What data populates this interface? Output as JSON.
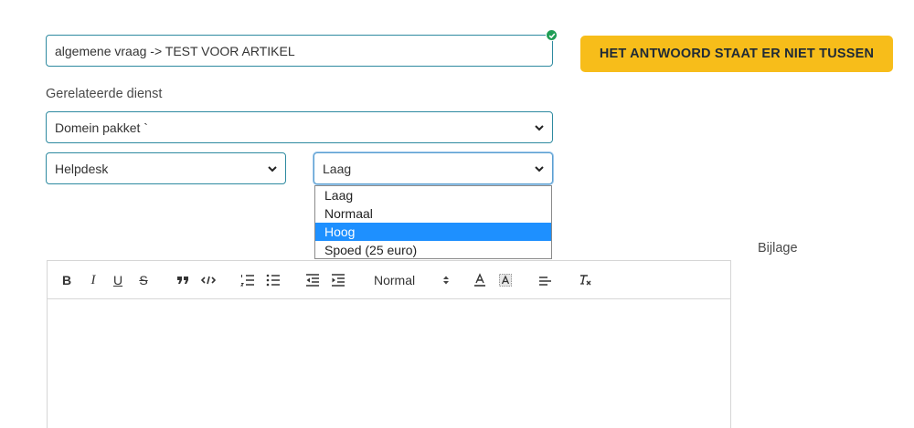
{
  "subject": {
    "value": "algemene vraag -> TEST VOOR ARTIKEL"
  },
  "answer_button": {
    "label": "HET ANTWOORD STAAT ER NIET TUSSEN"
  },
  "related_service": {
    "label": "Gerelateerde dienst",
    "selected": "Domein pakket `"
  },
  "department": {
    "selected": "Helpdesk"
  },
  "priority": {
    "selected": "Laag",
    "options": [
      "Laag",
      "Normaal",
      "Hoog",
      "Spoed (25 euro)"
    ],
    "highlighted": "Hoog"
  },
  "attachment": {
    "label": "Bijlage"
  },
  "toolbar": {
    "bold": "B",
    "italic": "I",
    "underline": "U",
    "strike": "S",
    "header_select": "Normal",
    "icons": [
      "bold-icon",
      "italic-icon",
      "underline-icon",
      "strike-icon",
      "quote-icon",
      "code-icon",
      "ordered-list-icon",
      "bullet-list-icon",
      "outdent-icon",
      "indent-icon",
      "font-color-icon",
      "background-color-icon",
      "align-icon",
      "clear-format-icon"
    ]
  },
  "colors": {
    "accent_button": "#f7bd1a",
    "field_border": "#2e8aa0",
    "highlight": "#1e90ff",
    "valid_check": "#1f9d55"
  }
}
